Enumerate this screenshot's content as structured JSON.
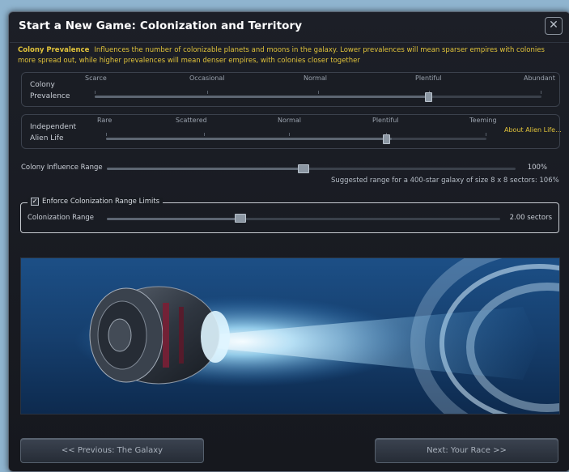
{
  "title": "Start a New Game: Colonization and Territory",
  "close_icon": "close-x-icon",
  "description": {
    "label": "Colony Prevalence",
    "text": "Influences the number of colonizable planets and moons in the galaxy. Lower prevalences will mean sparser empires with colonies more spread out, while higher prevalences will mean denser empires, with colonies closer together"
  },
  "colony_prevalence": {
    "label_line1": "Colony",
    "label_line2": "Prevalence",
    "options": [
      "Scarce",
      "Occasional",
      "Normal",
      "Plentiful",
      "Abundant"
    ],
    "selected": "Plentiful",
    "level": 0.75
  },
  "alien_life": {
    "label_line1": "Independent",
    "label_line2": "Alien Life",
    "options": [
      "Rare",
      "Scattered",
      "Normal",
      "Plentiful",
      "Teeming"
    ],
    "selected": "Plentiful",
    "level": 0.75,
    "about_link": "About Alien Life..."
  },
  "influence_range": {
    "label": "Colony Influence Range",
    "value": "100%",
    "level": 0.48,
    "suggestion": "Suggested range for a 400-star galaxy of size 8 x 8 sectors: 106%"
  },
  "colonization": {
    "checkbox_label": "Enforce Colonization Range Limits",
    "checked": true,
    "label": "Colonization Range",
    "value": "2.00 sectors",
    "level": 0.33
  },
  "buttons": {
    "previous": "<< Previous: The Galaxy",
    "next": "Next: Your Race >>"
  },
  "colors": {
    "accent_yellow": "#e0c23a",
    "frame": "#1c1f27",
    "background": "#8fb4cf"
  }
}
